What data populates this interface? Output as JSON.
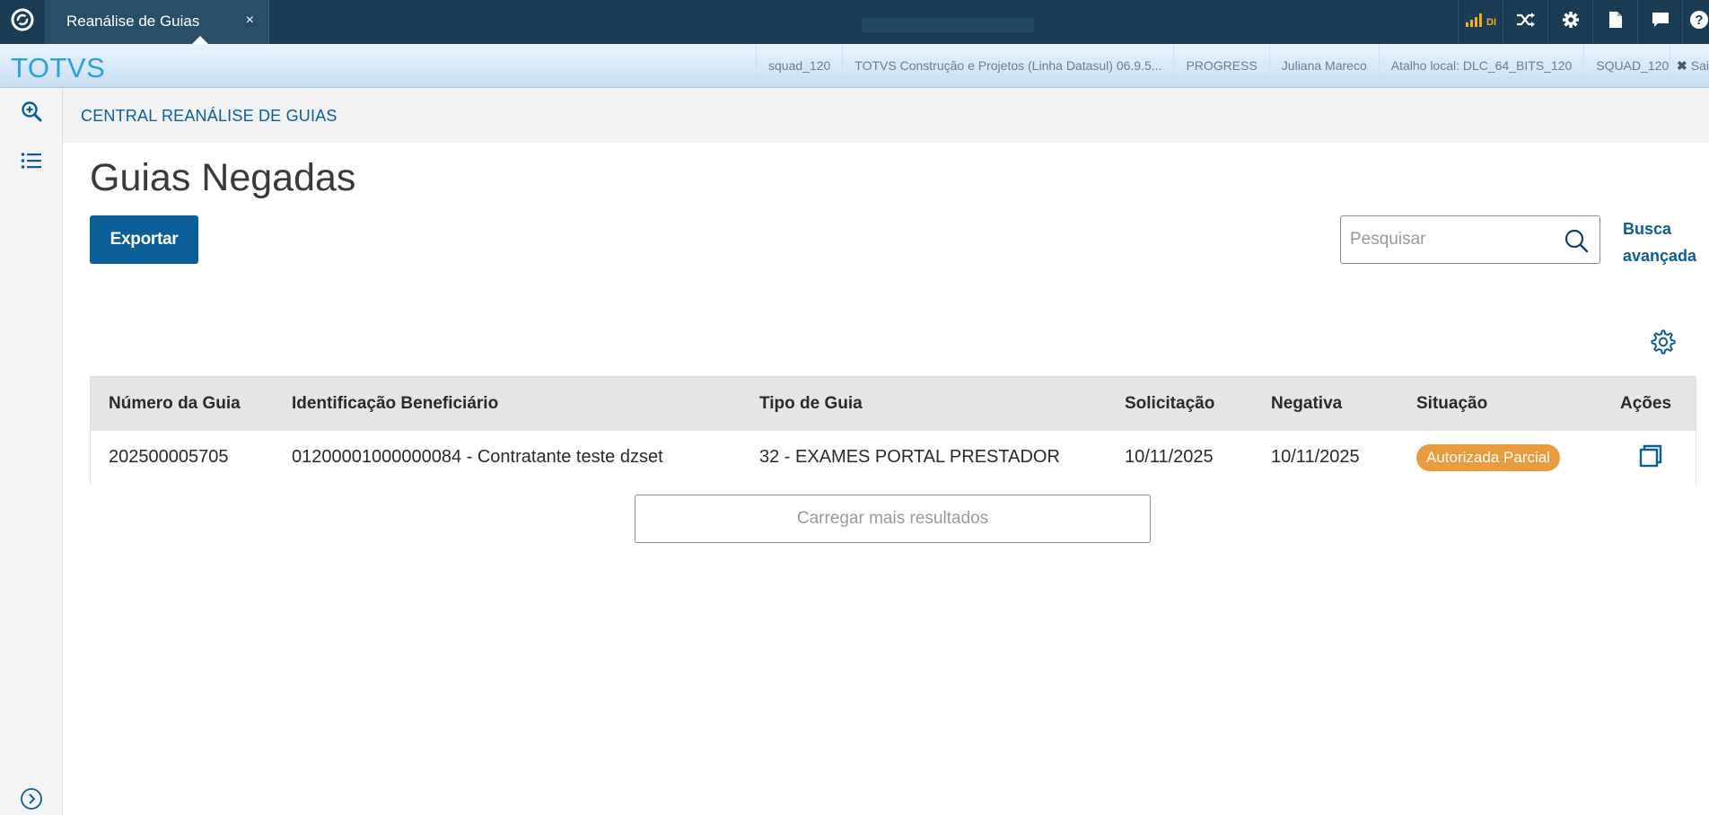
{
  "topbar": {
    "tab_title": "Reanálise de Guias",
    "tab_close": "×",
    "signal_text": "DI"
  },
  "infobar": {
    "brand": "TOTVS",
    "items": [
      "squad_120",
      "TOTVS Construção e Projetos (Linha Datasul) 06.9.5...",
      "PROGRESS",
      "Juliana Mareco",
      "Atalho local: DLC_64_BITS_120",
      "SQUAD_120"
    ],
    "exit_label": "Sai"
  },
  "breadcrumb": "CENTRAL REANÁLISE DE GUIAS",
  "page_title": "Guias Negadas",
  "export_label": "Exportar",
  "search": {
    "placeholder": "Pesquisar",
    "value": ""
  },
  "advanced_search": {
    "line1": "Busca",
    "line2": "avançada"
  },
  "table": {
    "columns": [
      "Número da Guia",
      "Identificação Beneficiário",
      "Tipo de Guia",
      "Solicitação",
      "Negativa",
      "Situação",
      "Ações"
    ],
    "rows": [
      {
        "numero": "202500005705",
        "beneficiario": "01200001000000084 - Contratante teste dzset",
        "tipo": "32 - EXAMES PORTAL PRESTADOR",
        "solicitacao": "10/11/2025",
        "negativa": "10/11/2025",
        "situacao": "Autorizada Parcial"
      }
    ]
  },
  "load_more_label": "Carregar mais resultados",
  "colors": {
    "topbar_bg": "#1a3d55",
    "primary": "#0c5e96",
    "brand_blue": "#2aa3dd",
    "badge_orange": "#ea9b3e",
    "signal_yellow": "#f2b01e"
  },
  "icons": {
    "app_logo": "totvs-logo-icon",
    "signal": "signal-bars-icon",
    "shuffle": "shuffle-icon",
    "settings": "gear-icon",
    "document": "document-icon",
    "chat": "chat-icon",
    "help": "help-icon",
    "zoom": "zoom-in-icon",
    "menu": "list-icon",
    "search": "search-icon",
    "table_settings": "gear-icon",
    "action": "copy-window-icon",
    "expand": "chevron-right-circle-icon"
  }
}
